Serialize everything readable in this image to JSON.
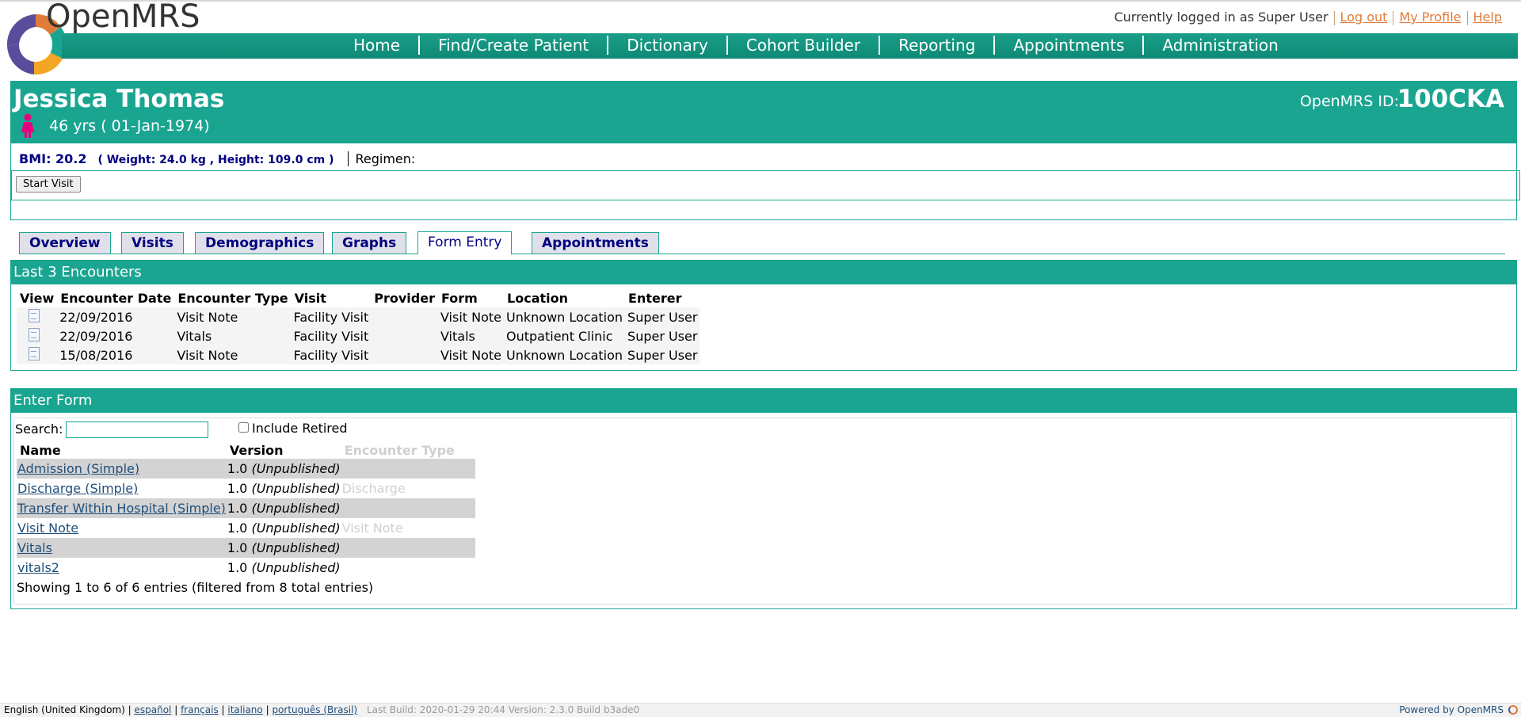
{
  "header": {
    "brand": "OpenMRS",
    "logged_in_text": "Currently logged in as Super User",
    "logout": "Log out",
    "my_profile": "My Profile",
    "help": "Help"
  },
  "nav": [
    "Home",
    "Find/Create Patient",
    "Dictionary",
    "Cohort Builder",
    "Reporting",
    "Appointments",
    "Administration"
  ],
  "patient": {
    "name": "Jessica Thomas",
    "age": "46 yrs ( 01-Jan-1974)",
    "id_label": "OpenMRS ID:",
    "id": "100CKA",
    "bmi": "BMI: 20.2",
    "bmi_detail": "( Weight: 24.0 kg , Height: 109.0 cm )",
    "regimen": "Regimen:",
    "start_visit": "Start Visit"
  },
  "tabs": [
    {
      "label": "Overview",
      "active": false
    },
    {
      "label": "Visits",
      "active": false
    },
    {
      "label": "Demographics",
      "active": false
    },
    {
      "label": "Graphs",
      "active": false
    },
    {
      "label": "Form Entry",
      "active": true
    },
    {
      "label": "Appointments",
      "active": false
    }
  ],
  "encounters": {
    "title": "Last 3 Encounters",
    "columns": [
      "View",
      "Encounter Date",
      "Encounter Type",
      "Visit",
      "Provider",
      "Form",
      "Location",
      "Enterer"
    ],
    "rows": [
      [
        "22/09/2016",
        "Visit Note",
        "Facility Visit",
        "",
        "Visit Note",
        "Unknown Location",
        "Super User"
      ],
      [
        "22/09/2016",
        "Vitals",
        "Facility Visit",
        "",
        "Vitals",
        "Outpatient Clinic",
        "Super User"
      ],
      [
        "15/08/2016",
        "Visit Note",
        "Facility Visit",
        "",
        "Visit Note",
        "Unknown Location",
        "Super User"
      ]
    ]
  },
  "enter_form": {
    "title": "Enter Form",
    "search_label": "Search:",
    "search_value": "",
    "include_retired": "Include Retired",
    "columns": [
      "Name",
      "Version",
      "Encounter Type"
    ],
    "rows": [
      {
        "name": "Admission (Simple)",
        "version": "1.0",
        "status": "(Unpublished)",
        "encounter_type": ""
      },
      {
        "name": "Discharge (Simple)",
        "version": "1.0",
        "status": "(Unpublished)",
        "encounter_type": "Discharge"
      },
      {
        "name": "Transfer Within Hospital (Simple)",
        "version": "1.0",
        "status": "(Unpublished)",
        "encounter_type": ""
      },
      {
        "name": "Visit Note",
        "version": "1.0",
        "status": "(Unpublished)",
        "encounter_type": "Visit Note"
      },
      {
        "name": "Vitals",
        "version": "1.0",
        "status": "(Unpublished)",
        "encounter_type": ""
      },
      {
        "name": "vitals2",
        "version": "1.0",
        "status": "(Unpublished)",
        "encounter_type": ""
      }
    ],
    "showing": "Showing 1 to 6 of 6 entries (filtered from 8 total entries)"
  },
  "footer": {
    "locale_current": "English (United Kingdom)",
    "locales": [
      "español",
      "français",
      "italiano",
      "português (Brasil)"
    ],
    "build": "Last Build: 2020-01-29 20:44   Version: 2.3.0 Build b3ade0",
    "powered_by": "Powered by OpenMRS"
  },
  "colors": {
    "teal": "#1aa591",
    "link": "#1f4e79",
    "orange": "#e07b39",
    "navy": "#000080"
  }
}
